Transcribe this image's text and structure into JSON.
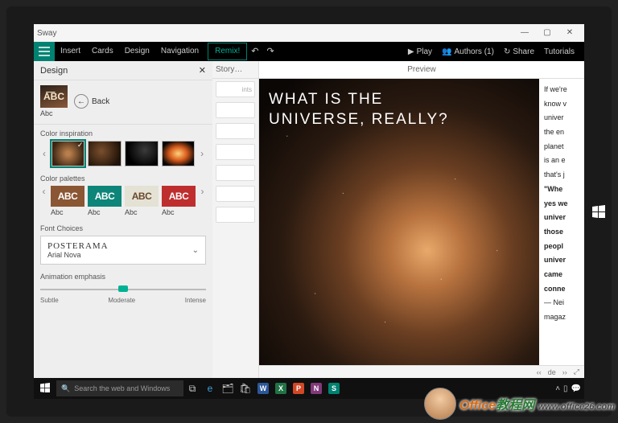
{
  "window": {
    "title": "Sway",
    "min": "—",
    "max": "▢",
    "close": "✕"
  },
  "menu": {
    "items": [
      "Insert",
      "Cards",
      "Design",
      "Navigation"
    ],
    "remix": "Remix!",
    "undo": "↶",
    "redo": "↷",
    "play": "Play",
    "authors": "Authors (1)",
    "share": "Share",
    "tutorials": "Tutorials"
  },
  "design": {
    "title": "Design",
    "back": "Back",
    "selected_label": "Abc",
    "color_inspiration": "Color inspiration",
    "color_palettes": "Color palettes",
    "palettes": [
      {
        "abc": "ABC",
        "lbl": "Abc"
      },
      {
        "abc": "ABC",
        "lbl": "Abc"
      },
      {
        "abc": "ABC",
        "lbl": "Abc"
      },
      {
        "abc": "ABC",
        "lbl": "Abc"
      }
    ],
    "font_choices": "Font Choices",
    "font1": "POSTERAMA",
    "font2": "Arial Nova",
    "animation": "Animation emphasis",
    "anim_labels": [
      "Subtle",
      "Moderate",
      "Intense"
    ]
  },
  "storyline": {
    "title": "Story…",
    "hint": "ints"
  },
  "preview": {
    "title": "Preview",
    "headline": "WHAT IS THE\nUNIVERSE, REALLY?",
    "side": [
      "If we're",
      "know v",
      "univer",
      "the en",
      "planet",
      "is an e",
      "that's j",
      "\"Whe",
      "yes we",
      "univer",
      "those",
      "peopl",
      "univer",
      "came",
      "conne",
      "— Nei",
      "magaz"
    ],
    "footer_page": "de"
  },
  "taskbar": {
    "search_placeholder": "Search the web and Windows"
  },
  "watermark": "Office教程网 www.office26.com"
}
